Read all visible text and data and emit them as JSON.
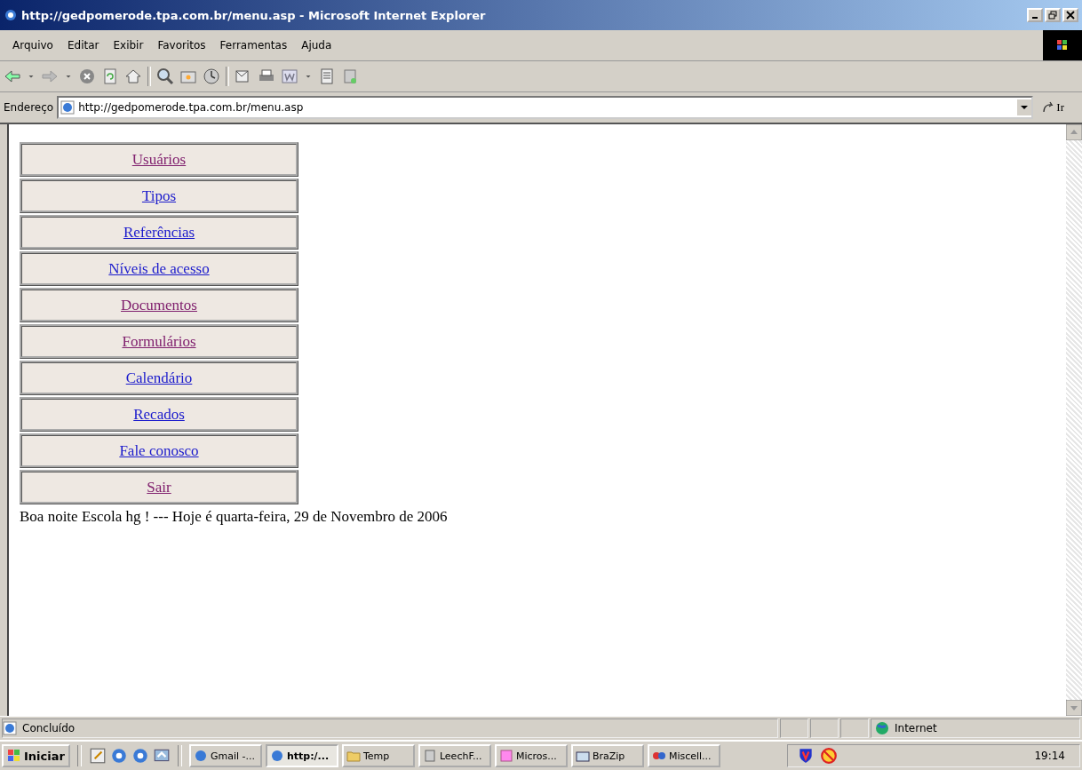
{
  "window": {
    "title": "http://gedpomerode.tpa.com.br/menu.asp - Microsoft Internet Explorer"
  },
  "menu_bar": [
    "Arquivo",
    "Editar",
    "Exibir",
    "Favoritos",
    "Ferramentas",
    "Ajuda"
  ],
  "address_bar": {
    "label": "Endereço",
    "value": "http://gedpomerode.tpa.com.br/menu.asp",
    "go_label": "Ir"
  },
  "page": {
    "menu_items": [
      {
        "label": "Usuários",
        "visited": true
      },
      {
        "label": "Tipos",
        "visited": false
      },
      {
        "label": "Referências",
        "visited": false
      },
      {
        "label": "Níveis de acesso",
        "visited": false
      },
      {
        "label": "Documentos",
        "visited": true
      },
      {
        "label": "Formulários",
        "visited": true
      },
      {
        "label": "Calendário",
        "visited": false
      },
      {
        "label": "Recados",
        "visited": false
      },
      {
        "label": "Fale conosco",
        "visited": false
      },
      {
        "label": "Sair",
        "visited": true
      }
    ],
    "greeting": "Boa noite Escola hg ! --- Hoje é quarta-feira, 29 de Novembro de 2006"
  },
  "status_bar": {
    "text": "Concluído",
    "zone": "Internet"
  },
  "taskbar": {
    "start": "Iniciar",
    "tasks": [
      {
        "label": "Gmail -...",
        "selected": false
      },
      {
        "label": "http:/...",
        "selected": true
      },
      {
        "label": "Temp",
        "selected": false
      },
      {
        "label": "LeechF...",
        "selected": false
      },
      {
        "label": "Micros...",
        "selected": false
      },
      {
        "label": "BraZip",
        "selected": false
      },
      {
        "label": "Miscell...",
        "selected": false
      }
    ],
    "clock": "19:14"
  }
}
